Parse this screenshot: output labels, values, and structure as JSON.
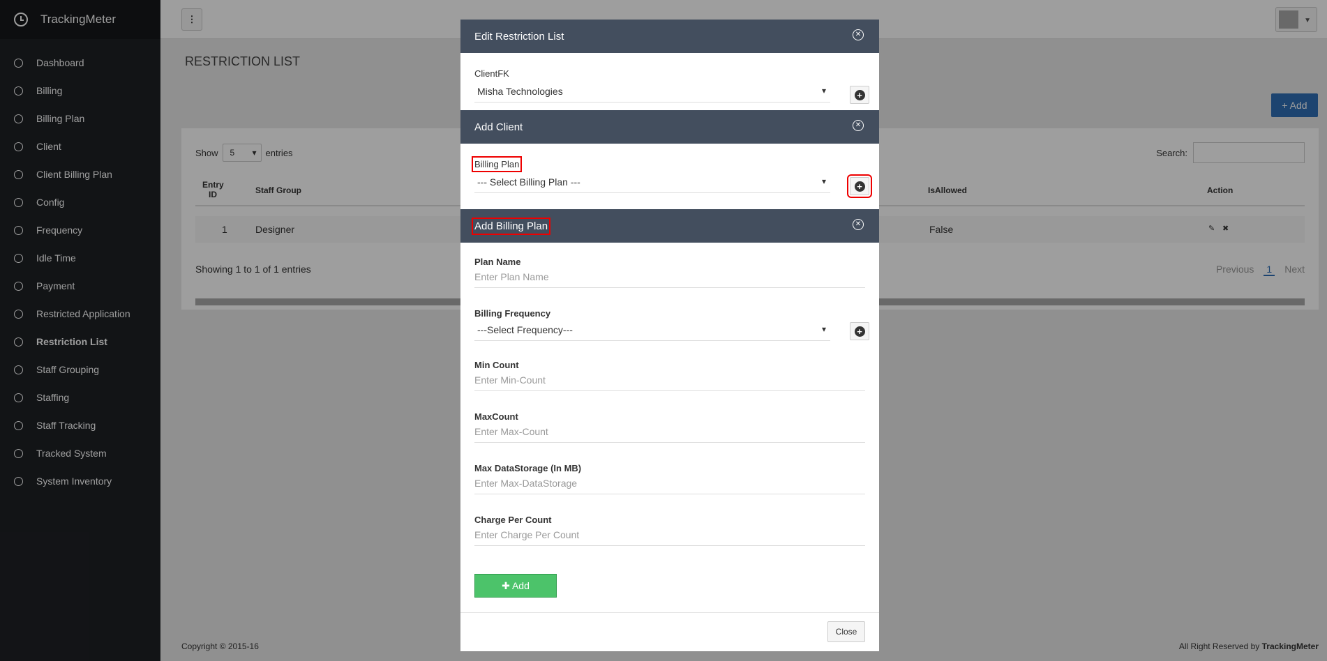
{
  "app": {
    "brand": "TrackingMeter"
  },
  "sidebar": {
    "items": [
      {
        "label": "Dashboard"
      },
      {
        "label": "Billing"
      },
      {
        "label": "Billing Plan"
      },
      {
        "label": "Client"
      },
      {
        "label": "Client Billing Plan"
      },
      {
        "label": "Config"
      },
      {
        "label": "Frequency"
      },
      {
        "label": "Idle Time"
      },
      {
        "label": "Payment"
      },
      {
        "label": "Restricted Application"
      },
      {
        "label": "Restriction List"
      },
      {
        "label": "Staff Grouping"
      },
      {
        "label": "Staffing"
      },
      {
        "label": "Staff Tracking"
      },
      {
        "label": "Tracked System"
      },
      {
        "label": "System Inventory"
      }
    ]
  },
  "page": {
    "title": "RESTRICTION LIST",
    "add_label": "+ Add",
    "show_label": "Show",
    "show_value": "5",
    "entries_label": "entries",
    "search_label": "Search:",
    "columns": [
      "Entry ID",
      "Staff Group",
      "IsAllowed",
      "Action"
    ],
    "row": {
      "id": "1",
      "group": "Designer",
      "allowed": "False"
    },
    "info": "Showing 1 to 1 of 1 entries",
    "pager": {
      "prev": "Previous",
      "current": "1",
      "next": "Next"
    }
  },
  "footer": {
    "copyright": "Copyright © 2015-16",
    "rights": "All Right Reserved by",
    "brand": "TrackingMeter"
  },
  "modal_edit": {
    "title": "Edit Restriction List",
    "client_label": "ClientFK",
    "client_value": "Misha Technologies"
  },
  "modal_client": {
    "title": "Add Client",
    "plan_label": "Billing Plan",
    "plan_value": "--- Select Billing Plan ---"
  },
  "modal_plan": {
    "title": "Add Billing Plan",
    "fields": [
      {
        "label": "Plan Name",
        "placeholder": "Enter Plan Name"
      },
      {
        "label": "Billing Frequency",
        "value": "---Select Frequency---"
      },
      {
        "label": "Min Count",
        "placeholder": "Enter Min-Count"
      },
      {
        "label": "MaxCount",
        "placeholder": "Enter Max-Count"
      },
      {
        "label": "Max DataStorage (In MB)",
        "placeholder": "Enter Max-DataStorage"
      },
      {
        "label": "Charge Per Count",
        "placeholder": "Enter Charge Per Count"
      }
    ],
    "add_label": "Add",
    "close_label": "Close"
  }
}
